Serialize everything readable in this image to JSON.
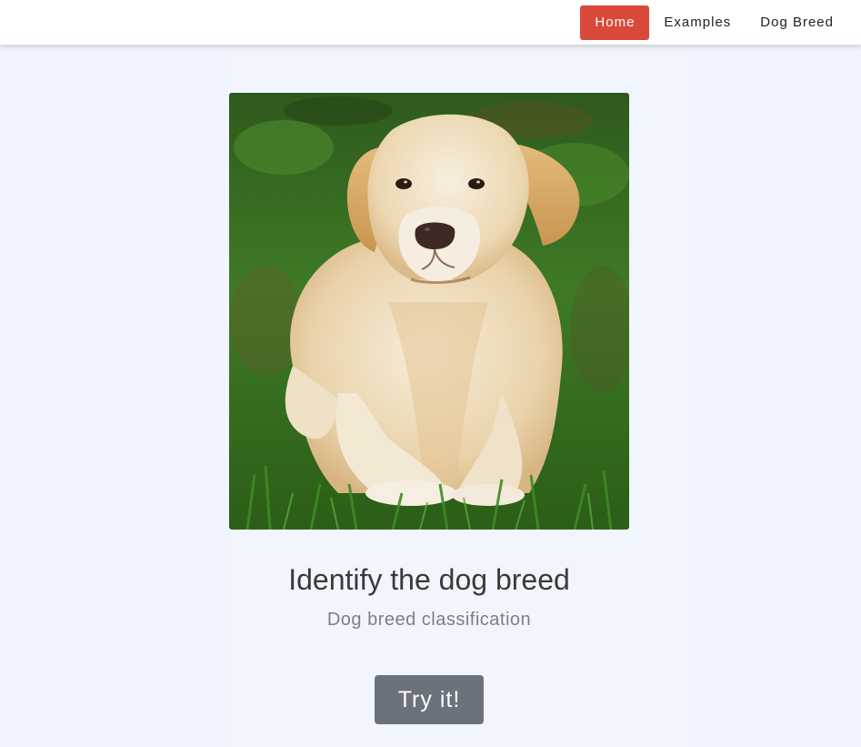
{
  "nav": {
    "items": [
      {
        "label": "Home",
        "active": true
      },
      {
        "label": "Examples",
        "active": false
      },
      {
        "label": "Dog Breed",
        "active": false
      }
    ],
    "active_color": "#d9493a"
  },
  "hero": {
    "image": "labrador-retriever-photo"
  },
  "main": {
    "title": "Identify the dog breed",
    "subtitle": "Dog breed classification",
    "cta_label": "Try it!"
  },
  "colors": {
    "page_background": "#eff4ff",
    "button": "#6c727c"
  }
}
